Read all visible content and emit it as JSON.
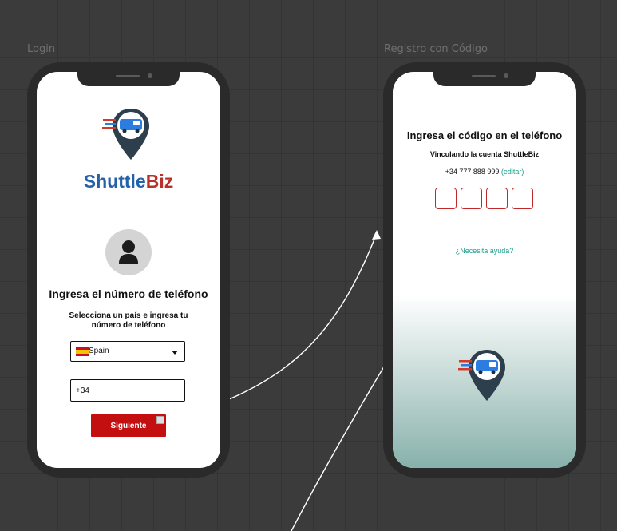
{
  "frames": {
    "login_label": "Login",
    "code_label": "Registro con Código"
  },
  "login": {
    "brand_part1": "Shuttle",
    "brand_part2": "Biz",
    "title": "Ingresa el número de teléfono",
    "subtitle": "Selecciona un país e ingresa tu número de teléfono",
    "country": {
      "selected": "Spain",
      "flag_icon": "spain-flag-icon"
    },
    "phone_field": {
      "value": "+34"
    },
    "next_button_label": "Siguiente"
  },
  "code": {
    "title": "Ingresa el código en el teléfono",
    "subtitle": "Vinculando la cuenta ShuttleBiz",
    "phone_number": "+34 777 888 999",
    "edit_link": "(editar)",
    "code_boxes": 4,
    "help_link": "¿Necesita ayuda?"
  },
  "colors": {
    "brand_blue": "#2461a8",
    "brand_red": "#b8322a",
    "button_red": "#c30f0f",
    "link_teal": "#1a9e8a",
    "gradient_bottom": "#88b1ab"
  }
}
